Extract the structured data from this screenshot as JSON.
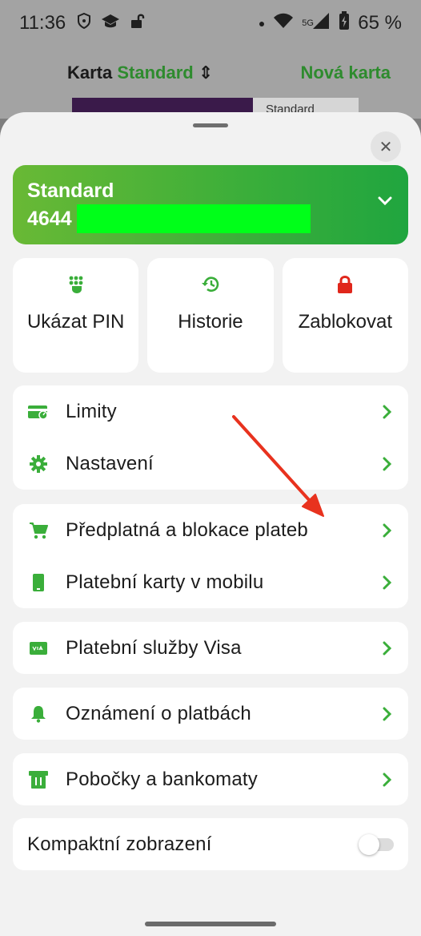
{
  "status_bar": {
    "time": "11:36",
    "battery": "65 %",
    "network": "5G"
  },
  "background": {
    "title_prefix": "Karta",
    "title_accent": "Standard",
    "new_card": "Nová karta",
    "card_tag": "Standard"
  },
  "card": {
    "name": "Standard",
    "number_prefix": "4644"
  },
  "tiles": [
    {
      "label": "Ukázat PIN",
      "icon": "keypad-icon"
    },
    {
      "label": "Historie",
      "icon": "history-icon"
    },
    {
      "label": "Zablokovat",
      "icon": "lock-icon"
    }
  ],
  "groups": [
    {
      "items": [
        {
          "label": "Limity",
          "icon": "limit-card-icon"
        },
        {
          "label": "Nastavení",
          "icon": "gear-icon"
        }
      ]
    },
    {
      "items": [
        {
          "label": "Předplatná a blokace plateb",
          "icon": "cart-icon"
        },
        {
          "label": "Platební karty v mobilu",
          "icon": "phone-icon"
        }
      ]
    },
    {
      "items": [
        {
          "label": "Platební služby Visa",
          "icon": "visa-icon"
        }
      ]
    },
    {
      "items": [
        {
          "label": "Oznámení o platbách",
          "icon": "bell-icon"
        }
      ]
    },
    {
      "items": [
        {
          "label": "Pobočky a bankomaty",
          "icon": "atm-icon"
        }
      ]
    }
  ],
  "compact_view": {
    "label": "Kompaktní zobrazení",
    "enabled": false
  },
  "colors": {
    "accent": "#3aae3a",
    "lock": "#e0261b",
    "annotation": "#e8321e"
  }
}
